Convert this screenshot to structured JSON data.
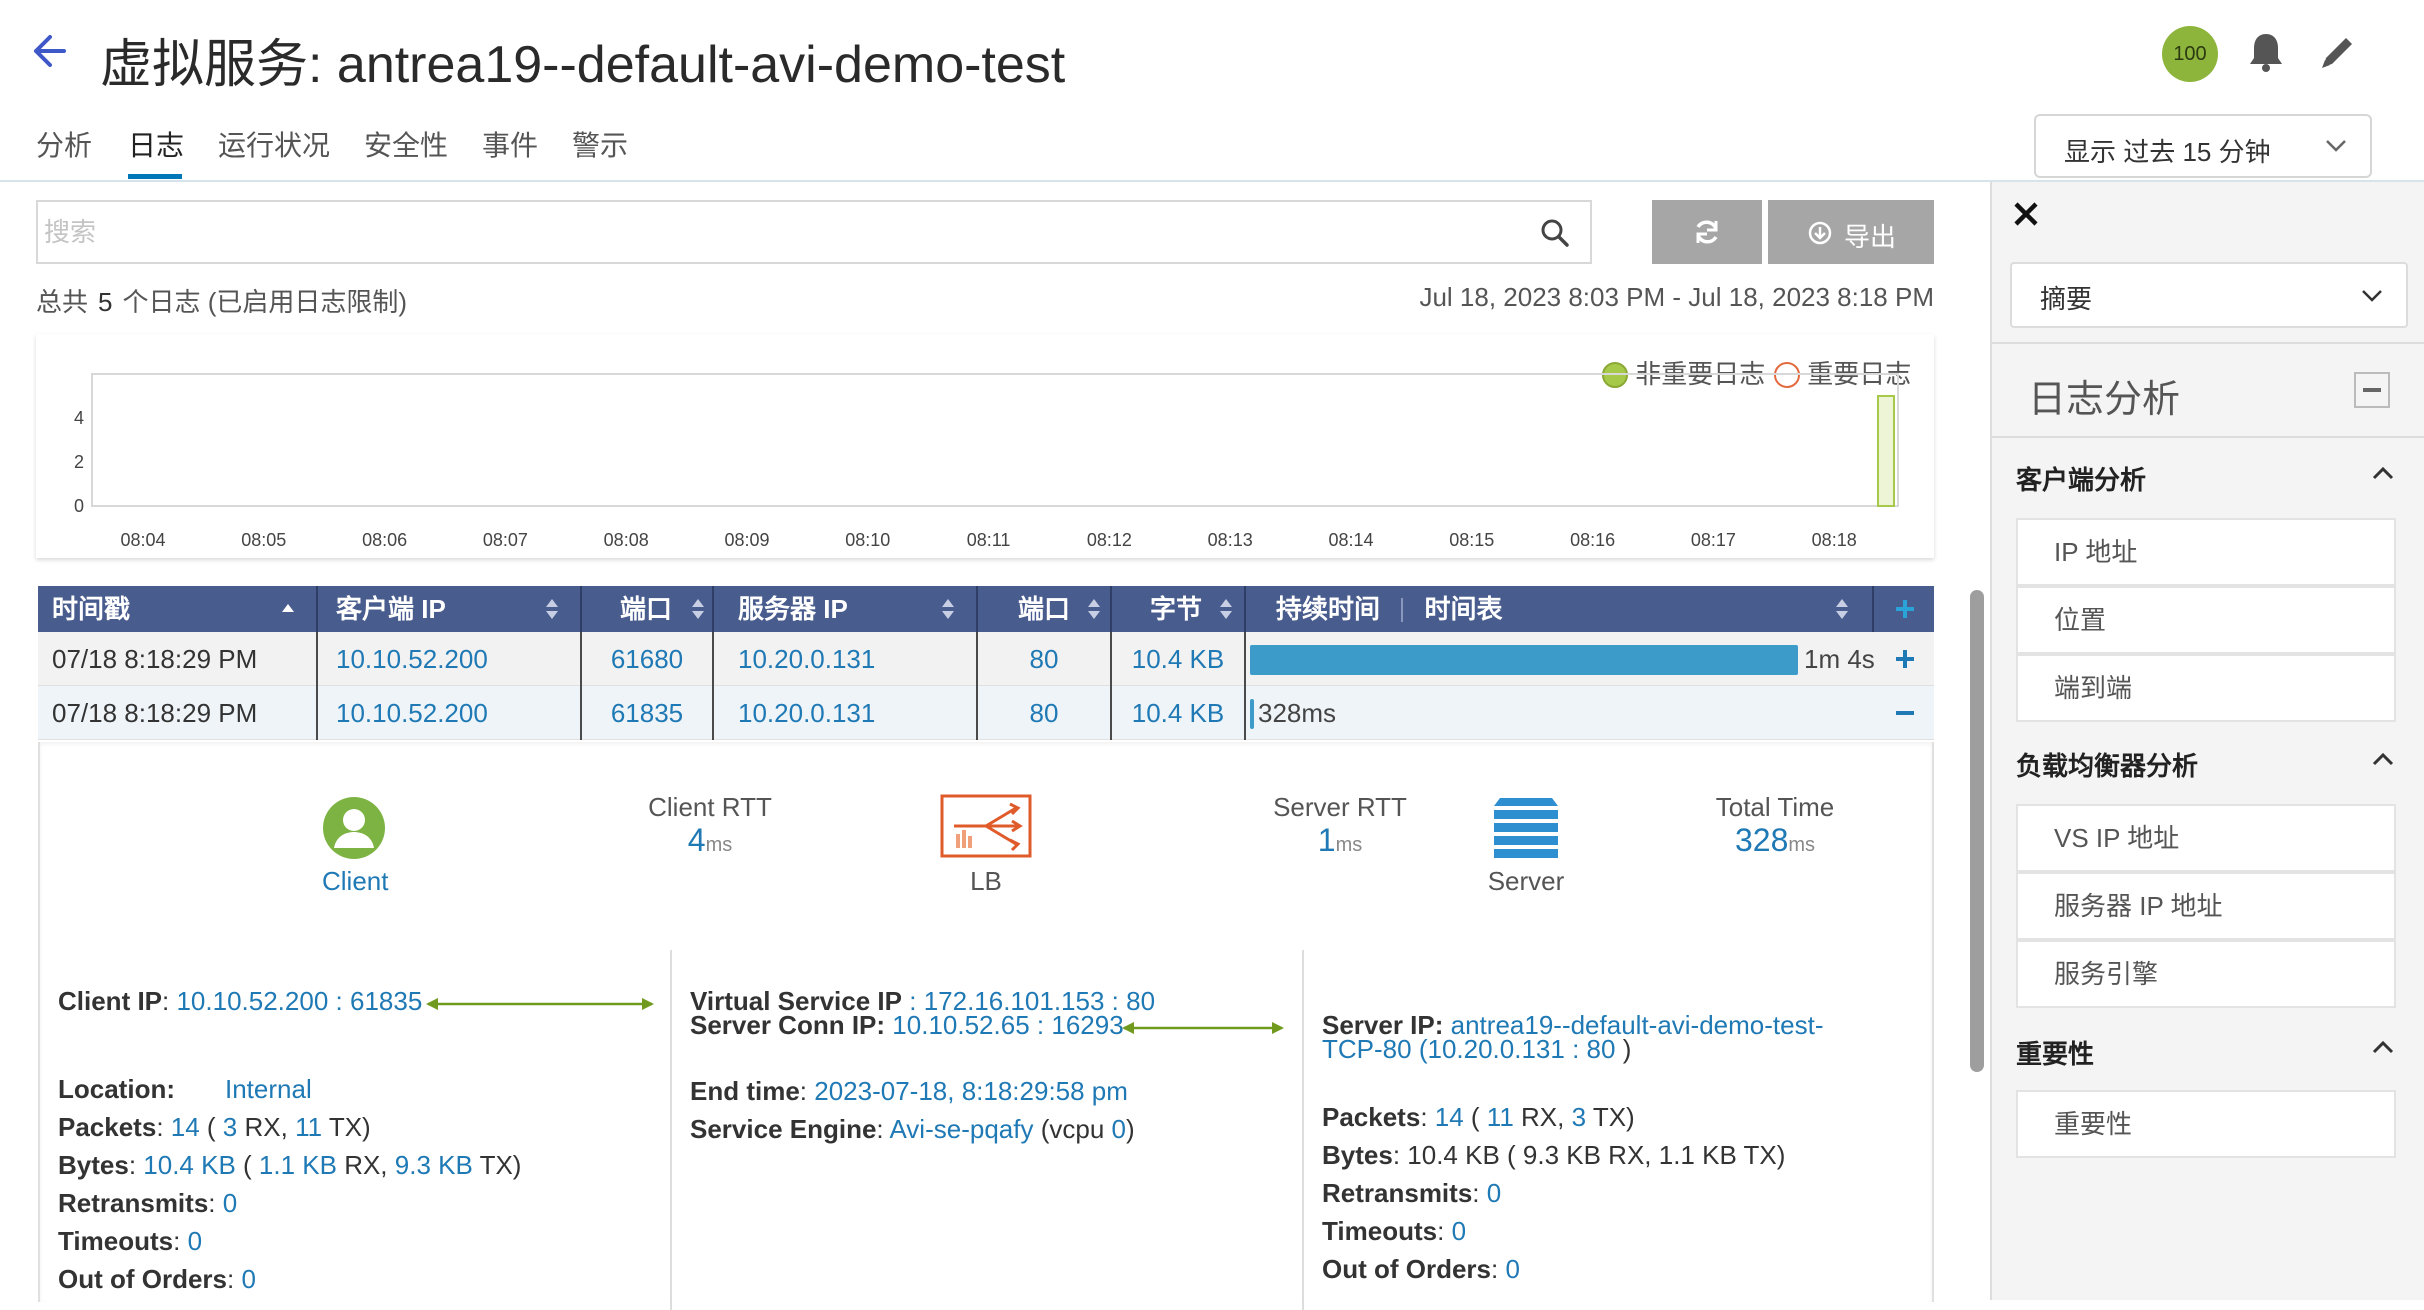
{
  "header": {
    "title": "虚拟服务: antrea19--default-avi-demo-test",
    "health_score": "100",
    "tabs": [
      "分析",
      "日志",
      "运行状况",
      "安全性",
      "事件",
      "警示"
    ],
    "active_tab": "日志",
    "time_range": "显示 过去 15 分钟"
  },
  "toolbar": {
    "search_placeholder": "搜索",
    "export_label": "导出",
    "total_prefix": "总共",
    "total_count": "5",
    "total_suffix": "个日志 (已启用日志限制)",
    "time_range_text": "Jul 18, 2023 8:03 PM - Jul 18, 2023 8:18 PM"
  },
  "chart_data": {
    "type": "bar",
    "legend": [
      "非重要日志",
      "重要日志"
    ],
    "y_ticks": [
      "4",
      "2",
      "0"
    ],
    "categories": [
      "08:04",
      "08:05",
      "08:06",
      "08:07",
      "08:08",
      "08:09",
      "08:10",
      "08:11",
      "08:12",
      "08:13",
      "08:14",
      "08:15",
      "08:16",
      "08:17",
      "08:18"
    ],
    "series": [
      {
        "name": "非重要日志",
        "values": [
          0,
          0,
          0,
          0,
          0,
          0,
          0,
          0,
          0,
          0,
          0,
          0,
          0,
          0,
          5
        ]
      },
      {
        "name": "重要日志",
        "values": [
          0,
          0,
          0,
          0,
          0,
          0,
          0,
          0,
          0,
          0,
          0,
          0,
          0,
          0,
          0
        ]
      }
    ],
    "ylim": [
      0,
      6
    ],
    "colors": {
      "non_significant": "#a7c94a",
      "significant": "#e36a3f"
    }
  },
  "table": {
    "headers": [
      "时间戳",
      "客户端 IP",
      "端口",
      "服务器 IP",
      "端口",
      "字节",
      "持续时间",
      "时间表"
    ],
    "rows": [
      {
        "timestamp": "07/18 8:18:29 PM",
        "client_ip": "10.10.52.200",
        "client_port": "61680",
        "server_ip": "10.20.0.131",
        "server_port": "80",
        "bytes": "10.4 KB",
        "duration": "1m 4s",
        "duration_fraction": 1.0
      },
      {
        "timestamp": "07/18 8:18:29 PM",
        "client_ip": "10.10.52.200",
        "client_port": "61835",
        "server_ip": "10.20.0.131",
        "server_port": "80",
        "bytes": "10.4 KB",
        "duration": "328ms",
        "duration_fraction": 0.005
      }
    ]
  },
  "detail": {
    "client_label": "Client",
    "client_rtt_label": "Client RTT",
    "client_rtt_value": "4",
    "client_rtt_unit": "ms",
    "lb_label": "LB",
    "server_rtt_label": "Server RTT",
    "server_rtt_value": "1",
    "server_rtt_unit": "ms",
    "server_label": "Server",
    "total_time_label": "Total Time",
    "total_time_value": "328",
    "total_time_unit": "ms",
    "col1": {
      "client_ip_label": "Client IP",
      "client_ip": "10.10.52.200",
      "client_port": "61835",
      "location_label": "Location:",
      "location": "Internal",
      "packets_label": "Packets",
      "packets": "14",
      "packets_rx": "3",
      "packets_tx": "11",
      "bytes_label": "Bytes",
      "bytes": "10.4 KB",
      "bytes_rx": "1.1 KB",
      "bytes_tx": "9.3 KB",
      "retransmits_label": "Retransmits",
      "retransmits": "0",
      "timeouts_label": "Timeouts",
      "timeouts": "0",
      "out_of_orders_label": "Out of Orders",
      "out_of_orders": "0"
    },
    "col2": {
      "vs_ip_label": "Virtual Service IP",
      "vs_ip": "172.16.101.153",
      "vs_port": "80",
      "server_conn_ip_label": "Server Conn IP:",
      "server_conn_ip": "10.10.52.65",
      "server_conn_port": "16293",
      "end_time_label": "End time",
      "end_time": "2023-07-18, 8:18:29:58 pm",
      "service_engine_label": "Service Engine",
      "service_engine": "Avi-se-pqafy",
      "vcpu_label": "(vcpu",
      "vcpu": "0"
    },
    "col3": {
      "server_ip_label": "Server IP:",
      "server_name_1": "antrea19--default-avi-demo-test-",
      "server_name_2": "TCP-80",
      "server_ip": "10.20.0.131",
      "server_port": "80",
      "packets_label": "Packets",
      "packets": "14",
      "packets_rx": "11",
      "packets_tx": "3",
      "bytes_label": "Bytes",
      "bytes_text": "10.4 KB ( 9.3 KB RX, 1.1 KB TX)",
      "retransmits_label": "Retransmits",
      "retransmits": "0",
      "timeouts_label": "Timeouts",
      "timeouts": "0",
      "out_of_orders_label": "Out of Orders",
      "out_of_orders": "0"
    }
  },
  "right_panel": {
    "dropdown_value": "摘要",
    "title": "日志分析",
    "sections": [
      {
        "title": "客户端分析",
        "items": [
          "IP 地址",
          "位置",
          "端到端"
        ]
      },
      {
        "title": "负载均衡器分析",
        "items": [
          "VS IP 地址",
          "服务器 IP 地址",
          "服务引擎"
        ]
      },
      {
        "title": "重要性",
        "items": [
          "重要性"
        ]
      }
    ]
  },
  "colors": {
    "accent": "#0077b8",
    "table_header": "#495c8e",
    "link": "#1f79b5",
    "health": "#8db53c",
    "duration_bar": "#3d9bc9",
    "arrow": "#6f9a1e"
  }
}
